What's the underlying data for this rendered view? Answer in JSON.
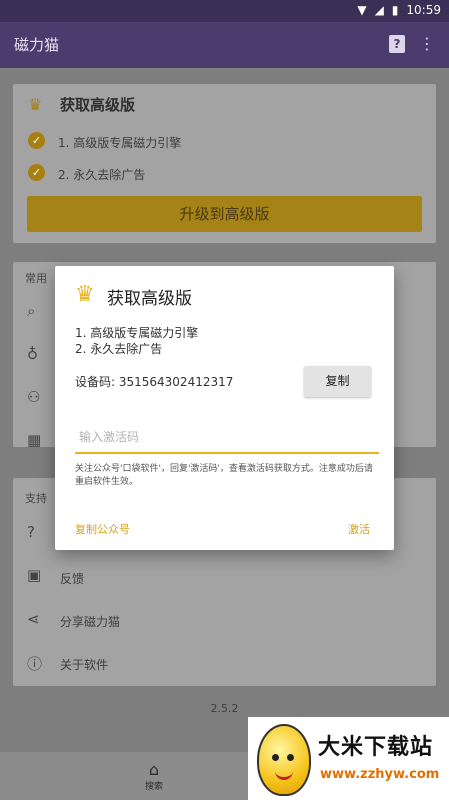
{
  "status": {
    "time": "10:59"
  },
  "app_bar": {
    "title": "磁力猫",
    "help_icon": "help-icon",
    "more_icon": "more-vert-icon"
  },
  "premium_card": {
    "title": "获取高级版",
    "features": [
      "1. 高级版专属磁力引擎",
      "2. 永久去除广告"
    ],
    "upgrade_label": "升级到高级版"
  },
  "common_section": {
    "label": "常用"
  },
  "support_section": {
    "label": "支持",
    "items": [
      "反馈",
      "分享磁力猫",
      "关于软件"
    ]
  },
  "version": "2.5.2",
  "bottom_nav": {
    "home_label": "搜索"
  },
  "dialog": {
    "title": "获取高级版",
    "features": [
      "1. 高级版专属磁力引擎",
      "2. 永久去除广告"
    ],
    "device_code": "设备码: 351564302412317",
    "copy_label": "复制",
    "input_placeholder": "输入激活码",
    "hint": "关注公众号'口袋软件'，回复'激活码'，查看激活码获取方式。注意成功后请重启软件生效。",
    "copy_account_label": "复制公众号",
    "activate_label": "激活",
    "accent_color": "#e7b424"
  },
  "watermark": {
    "title": "大米下载站",
    "url": "www.zzhyw.com"
  }
}
